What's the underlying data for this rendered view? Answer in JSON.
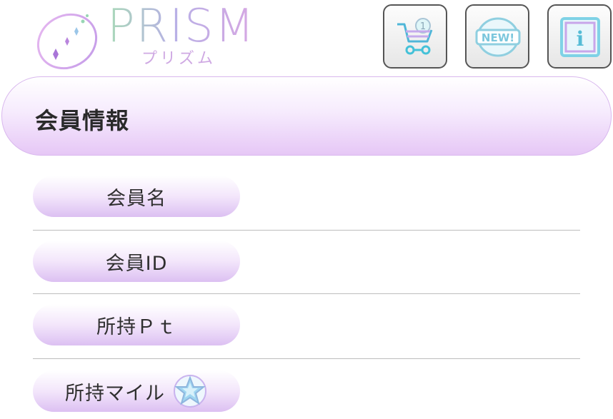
{
  "header": {
    "logo": {
      "title": "PRISM",
      "subtitle": "プリズム"
    },
    "buttons": [
      {
        "id": "cart",
        "icon": "cart-icon"
      },
      {
        "id": "new",
        "icon": "new-badge-icon",
        "text": "NEW!"
      },
      {
        "id": "info",
        "icon": "info-icon",
        "text": "i"
      }
    ]
  },
  "section": {
    "title": "会員情報"
  },
  "rows": [
    {
      "label": "会員名",
      "value": ""
    },
    {
      "label": "会員ID",
      "value": ""
    },
    {
      "label": "所持Ｐｔ",
      "value": ""
    },
    {
      "label": "所持マイル",
      "value": "",
      "icon": "star-medal-icon"
    }
  ],
  "colors": {
    "accent": "#e6c7f6",
    "border": "#d9b8ee"
  }
}
